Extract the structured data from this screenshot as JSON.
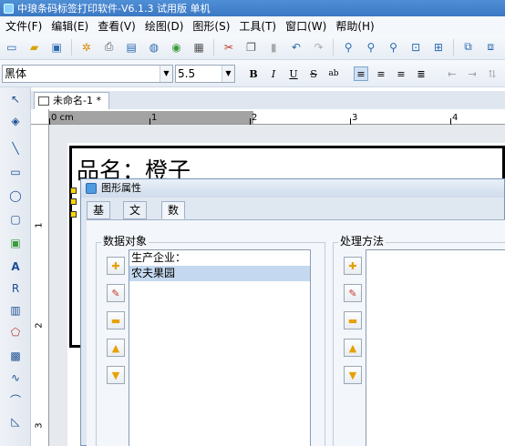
{
  "window": {
    "title": "中琅条码标签打印软件-V6.1.3 试用版 单机"
  },
  "menu": [
    "文件(F)",
    "编辑(E)",
    "查看(V)",
    "绘图(D)",
    "图形(S)",
    "工具(T)",
    "窗口(W)",
    "帮助(H)"
  ],
  "font_toolbar": {
    "font_name": "黑体",
    "font_size": "5.5",
    "bold": "B",
    "italic": "I",
    "underline": "U",
    "strike": "S"
  },
  "document": {
    "tab_title": "未命名-1 *"
  },
  "ruler": {
    "h_labels": [
      "0 cm",
      "1",
      "2",
      "3",
      "4"
    ],
    "v_labels": [
      "1",
      "2",
      "3"
    ]
  },
  "label_canvas": {
    "product_text": "品名：橙子"
  },
  "dialog": {
    "title": "图形属性",
    "tabs": [
      "基本",
      "文字",
      "数据源"
    ],
    "active_tab": "数据源",
    "data_objects_label": "数据对象",
    "processing_label": "处理方法",
    "data_objects": [
      "生产企业：",
      "农夫果园"
    ],
    "selected_index": 1
  }
}
